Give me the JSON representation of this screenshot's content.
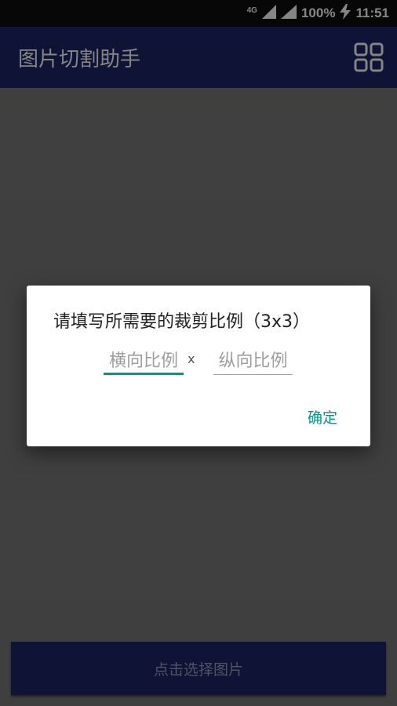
{
  "status_bar": {
    "network": "4G",
    "battery": "100%",
    "time": "11:51"
  },
  "app_bar": {
    "title": "图片切割助手",
    "grid_icon": "grid-icon"
  },
  "main": {
    "select_button_label": "点击选择图片"
  },
  "dialog": {
    "title": "请填写所需要的裁剪比例（3x3）",
    "horizontal_placeholder": "横向比例",
    "separator": "x",
    "vertical_placeholder": "纵向比例",
    "confirm_label": "确定"
  },
  "colors": {
    "primary": "#1e2566",
    "accent": "#009688"
  }
}
